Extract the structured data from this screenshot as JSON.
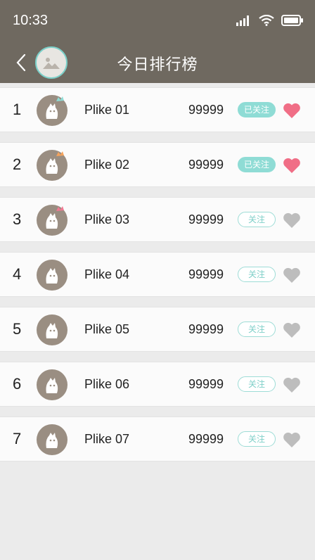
{
  "status": {
    "time": "10:33"
  },
  "nav": {
    "title": "今日排行榜"
  },
  "colors": {
    "header_bg": "#6f6960",
    "accent": "#8fdcd5",
    "heart_liked": "#f06e86",
    "heart_unliked": "#bdbdbd"
  },
  "rows": [
    {
      "rank": "1",
      "name": "Plike 01",
      "score": "99999",
      "follow_label": "已关注",
      "followed": true,
      "liked": true,
      "crown": "#8fdcd5"
    },
    {
      "rank": "2",
      "name": "Plike 02",
      "score": "99999",
      "follow_label": "已关注",
      "followed": true,
      "liked": true,
      "crown": "#f5a35c"
    },
    {
      "rank": "3",
      "name": "Plike 03",
      "score": "99999",
      "follow_label": "关注",
      "followed": false,
      "liked": false,
      "crown": "#f07a93"
    },
    {
      "rank": "4",
      "name": "Plike 04",
      "score": "99999",
      "follow_label": "关注",
      "followed": false,
      "liked": false,
      "crown": ""
    },
    {
      "rank": "5",
      "name": "Plike 05",
      "score": "99999",
      "follow_label": "关注",
      "followed": false,
      "liked": false,
      "crown": ""
    },
    {
      "rank": "6",
      "name": "Plike 06",
      "score": "99999",
      "follow_label": "关注",
      "followed": false,
      "liked": false,
      "crown": ""
    },
    {
      "rank": "7",
      "name": "Plike 07",
      "score": "99999",
      "follow_label": "关注",
      "followed": false,
      "liked": false,
      "crown": ""
    }
  ]
}
